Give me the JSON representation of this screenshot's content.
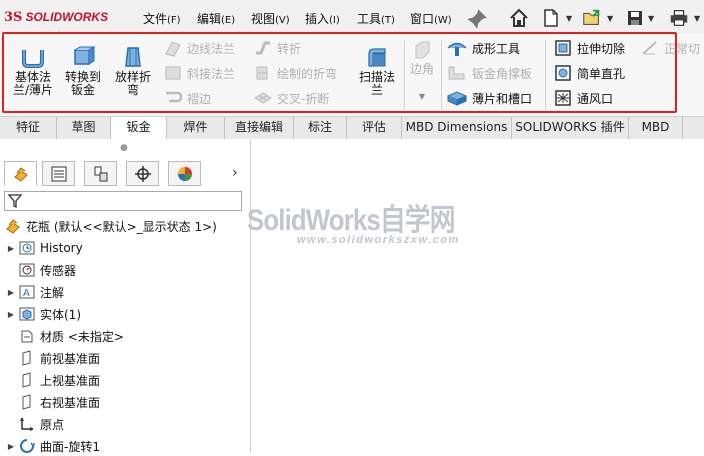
{
  "app": {
    "logo_ds": "3S",
    "logo_text": "SOLIDWORKS"
  },
  "menu": [
    {
      "label": "文件",
      "key": "(F)"
    },
    {
      "label": "编辑",
      "key": "(E)"
    },
    {
      "label": "视图",
      "key": "(V)"
    },
    {
      "label": "插入",
      "key": "(I)"
    },
    {
      "label": "工具",
      "key": "(T)"
    },
    {
      "label": "窗口",
      "key": "(W)"
    }
  ],
  "quick_access": [
    "pin-icon",
    "home-icon",
    "new-document-icon",
    "open-icon",
    "save-icon",
    "print-icon"
  ],
  "commands": {
    "base_flange": "基体法\n兰/薄片",
    "convert_sheet": "转换到\n钣金",
    "lofted_bend": "放样折\n弯",
    "edge_flange": "边线法兰",
    "miter_flange": "斜接法兰",
    "hem": "褶边",
    "jog": "转折",
    "sketched_bend": "绘制的折弯",
    "cross_break": "交叉-折断",
    "swept_flange": "扫描法\n兰",
    "corners": "边角",
    "forming_tool": "成形工具",
    "gusset": "钣金角撑板",
    "tab_slot": "薄片和槽口",
    "extruded_cut": "拉伸切除",
    "simple_hole": "简单直孔",
    "vent": "通风口",
    "normal_cut": "正常切"
  },
  "tabs": [
    "特征",
    "草图",
    "钣金",
    "焊件",
    "直接编辑",
    "标注",
    "评估",
    "MBD Dimensions",
    "SOLIDWORKS 插件",
    "MBD"
  ],
  "active_tab": "钣金",
  "tree": {
    "root": "花瓶  (默认<<默认>_显示状态 1>)",
    "items": [
      "History",
      "传感器",
      "注解",
      "实体(1)",
      "材质 <未指定>",
      "前视基准面",
      "上视基准面",
      "右视基准面",
      "原点",
      "曲面-旋转1"
    ]
  },
  "watermark": {
    "title": "SolidWorks自学网",
    "url": "www.solidworkszxw.com"
  },
  "colors": {
    "highlight_border": "#e02020",
    "brand_red": "#c8102e",
    "icon_blue": "#2a6fb0"
  }
}
